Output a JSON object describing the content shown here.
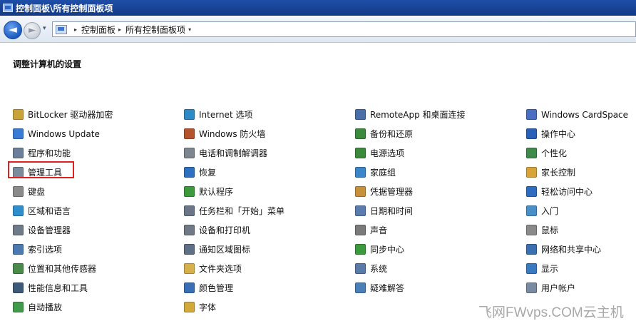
{
  "window": {
    "title": "控制面板\\所有控制面板项"
  },
  "nav": {
    "back_glyph": "◄",
    "forward_glyph": "►",
    "history_glyph": "▾",
    "breadcrumb_sep": "▸",
    "breadcrumbs": [
      "控制面板",
      "所有控制面板项"
    ],
    "crumb_dropdown": "▾"
  },
  "page": {
    "title": "调整计算机的设置"
  },
  "columns": [
    [
      {
        "label": "BitLocker 驱动器加密",
        "icon": "bitlocker-key-icon",
        "color": "#c9a23a"
      },
      {
        "label": "Windows Update",
        "icon": "windows-update-icon",
        "color": "#3a7bd5"
      },
      {
        "label": "程序和功能",
        "icon": "programs-icon",
        "color": "#6b7f9a"
      },
      {
        "label": "管理工具",
        "icon": "admin-tools-icon",
        "color": "#7a8b9c"
      },
      {
        "label": "键盘",
        "icon": "keyboard-icon",
        "color": "#8a8a8a"
      },
      {
        "label": "区域和语言",
        "icon": "globe-icon",
        "color": "#2f8fce"
      },
      {
        "label": "设备管理器",
        "icon": "device-manager-icon",
        "color": "#6f7b88"
      },
      {
        "label": "索引选项",
        "icon": "indexing-icon",
        "color": "#4a7ab0"
      },
      {
        "label": "位置和其他传感器",
        "icon": "sensor-icon",
        "color": "#4a8a4a"
      },
      {
        "label": "性能信息和工具",
        "icon": "performance-icon",
        "color": "#3e5a7a"
      },
      {
        "label": "自动播放",
        "icon": "autoplay-icon",
        "color": "#3f9a4a"
      }
    ],
    [
      {
        "label": "Internet 选项",
        "icon": "internet-options-icon",
        "color": "#2e8ac4"
      },
      {
        "label": "Windows 防火墙",
        "icon": "firewall-icon",
        "color": "#b5532e"
      },
      {
        "label": "电话和调制解调器",
        "icon": "modem-icon",
        "color": "#7c8590"
      },
      {
        "label": "恢复",
        "icon": "recovery-icon",
        "color": "#2f6fc0"
      },
      {
        "label": "默认程序",
        "icon": "default-programs-icon",
        "color": "#3c9a3c"
      },
      {
        "label": "任务栏和「开始」菜单",
        "icon": "taskbar-icon",
        "color": "#6b7788"
      },
      {
        "label": "设备和打印机",
        "icon": "printer-icon",
        "color": "#707a86"
      },
      {
        "label": "通知区域图标",
        "icon": "notification-icon",
        "color": "#5f6f86"
      },
      {
        "label": "文件夹选项",
        "icon": "folder-options-icon",
        "color": "#d6b04a"
      },
      {
        "label": "颜色管理",
        "icon": "color-management-icon",
        "color": "#3a6fb8"
      },
      {
        "label": "字体",
        "icon": "fonts-icon",
        "color": "#d2a93a"
      }
    ],
    [
      {
        "label": "RemoteApp 和桌面连接",
        "icon": "remoteapp-icon",
        "color": "#4a6fa8"
      },
      {
        "label": "备份和还原",
        "icon": "backup-icon",
        "color": "#3c8a3c"
      },
      {
        "label": "电源选项",
        "icon": "power-icon",
        "color": "#3b8a3b"
      },
      {
        "label": "家庭组",
        "icon": "homegroup-icon",
        "color": "#3a86c8"
      },
      {
        "label": "凭据管理器",
        "icon": "credential-icon",
        "color": "#c6913a"
      },
      {
        "label": "日期和时间",
        "icon": "clock-icon",
        "color": "#5a7db0"
      },
      {
        "label": "声音",
        "icon": "sound-icon",
        "color": "#7a7a7a"
      },
      {
        "label": "同步中心",
        "icon": "sync-icon",
        "color": "#3b9a3b"
      },
      {
        "label": "系统",
        "icon": "system-icon",
        "color": "#5a7aa8"
      },
      {
        "label": "疑难解答",
        "icon": "troubleshoot-icon",
        "color": "#4a7fb8"
      }
    ],
    [
      {
        "label": "Windows CardSpace",
        "icon": "cardspace-icon",
        "color": "#4a6ec0"
      },
      {
        "label": "操作中心",
        "icon": "action-center-flag-icon",
        "color": "#2a5fb8"
      },
      {
        "label": "个性化",
        "icon": "personalization-icon",
        "color": "#3f8a4a"
      },
      {
        "label": "家长控制",
        "icon": "parental-controls-icon",
        "color": "#d8a43a"
      },
      {
        "label": "轻松访问中心",
        "icon": "ease-of-access-icon",
        "color": "#2e6cc0"
      },
      {
        "label": "入门",
        "icon": "getting-started-icon",
        "color": "#4a90c8"
      },
      {
        "label": "鼠标",
        "icon": "mouse-icon",
        "color": "#8a8a8a"
      },
      {
        "label": "网络和共享中心",
        "icon": "network-icon",
        "color": "#3a6fb0"
      },
      {
        "label": "显示",
        "icon": "display-icon",
        "color": "#3a7ac0"
      },
      {
        "label": "用户帐户",
        "icon": "user-accounts-icon",
        "color": "#7a8aa0"
      }
    ]
  ],
  "watermark": "飞网FWvps.COM云主机"
}
